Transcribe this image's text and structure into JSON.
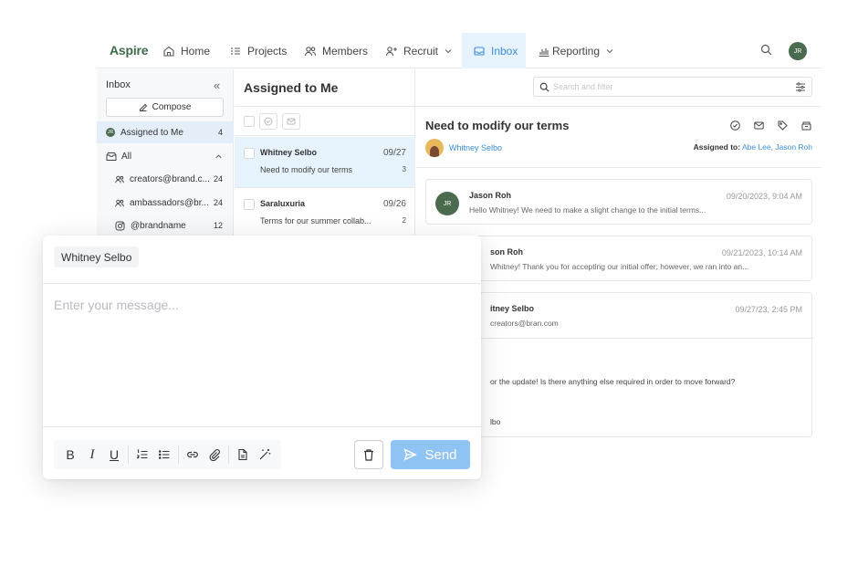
{
  "nav": {
    "logo": "Aspire",
    "items": [
      {
        "label": "Home",
        "icon": "home-icon"
      },
      {
        "label": "Projects",
        "icon": "list-icon"
      },
      {
        "label": "Members",
        "icon": "members-icon"
      },
      {
        "label": "Recruit",
        "icon": "recruit-icon"
      },
      {
        "label": "Inbox",
        "icon": "inbox-icon"
      },
      {
        "label": "Reporting",
        "icon": "chart-icon"
      }
    ],
    "active": "Inbox",
    "user_initials": "JR"
  },
  "sidebar": {
    "title": "Inbox",
    "compose_label": "Compose",
    "items": [
      {
        "label": "Assigned to Me",
        "count": "4",
        "active": true
      },
      {
        "label": "All",
        "count": ""
      },
      {
        "label": "creators@brand.c...",
        "count": "24"
      },
      {
        "label": "ambassadors@br...",
        "count": "24"
      },
      {
        "label": "@brandname",
        "count": "12"
      }
    ]
  },
  "list": {
    "title": "Assigned to Me",
    "search_placeholder": "Search and filter",
    "messages": [
      {
        "from": "Whitney Selbo",
        "date": "09/27",
        "subject": "Need to modify our terms",
        "count": "3",
        "active": true
      },
      {
        "from": "Saraluxuria",
        "date": "09/26",
        "subject": "Terms for our summer collab...",
        "count": "2"
      }
    ]
  },
  "detail": {
    "subject": "Need to modify our terms",
    "from": "Whitney Selbo",
    "assigned_label": "Assigned to:",
    "assigned_to": "Abe Lee, Jason Roh",
    "thread": [
      {
        "sender": "Jason Roh",
        "initials": "JR",
        "time": "09/20/2023, 9:04 AM",
        "preview": "Hello Whitney! We need to make a slight change to the initial terms..."
      },
      {
        "sender": "son Roh",
        "time": "09/21/2023, 10:14 AM",
        "preview": "Whitney! Thank you for accepting our initial offer; however, we ran into an..."
      },
      {
        "sender": "itney Selbo",
        "time": "09/27/23, 2:45 PM",
        "to": "creators@bran.com",
        "body": "or the update! Is there anything else required in order to move forward?",
        "signature": "lbo"
      }
    ]
  },
  "composer": {
    "recipient": "Whitney Selbo",
    "placeholder": "Enter your message...",
    "send_label": "Send",
    "tools": [
      "bold-icon",
      "italic-icon",
      "underline-icon",
      "numbered-list-icon",
      "bullet-list-icon",
      "link-icon",
      "attachment-icon",
      "document-icon",
      "magic-wand-icon",
      "trash-icon",
      "send-icon"
    ],
    "colors": {
      "send_button": "#8fc3f3",
      "accent": "#3a8ddb",
      "brand": "#3f6b4c"
    }
  }
}
